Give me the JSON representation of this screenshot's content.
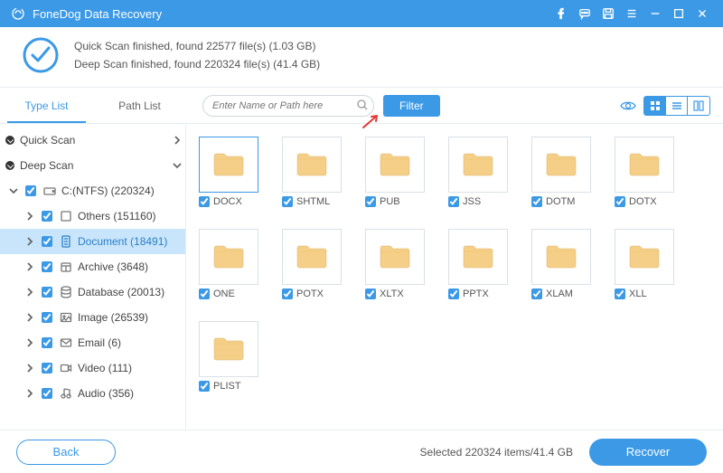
{
  "app_title": "FoneDog Data Recovery",
  "scan_status": {
    "quick": "Quick Scan finished, found 22577 file(s) (1.03 GB)",
    "deep": "Deep Scan finished, found 220324 file(s) (41.4 GB)"
  },
  "tabs": {
    "type_list": "Type List",
    "path_list": "Path List"
  },
  "toolbar": {
    "search_placeholder": "Enter Name or Path here",
    "filter": "Filter"
  },
  "tree": {
    "quick_scan": "Quick Scan",
    "deep_scan": "Deep Scan",
    "drive": "C:(NTFS) (220324)",
    "children": [
      {
        "label": "Others (151160)",
        "icon": "others"
      },
      {
        "label": "Document (18491)",
        "icon": "document",
        "active": true
      },
      {
        "label": "Archive (3648)",
        "icon": "archive"
      },
      {
        "label": "Database (20013)",
        "icon": "database"
      },
      {
        "label": "Image (26539)",
        "icon": "image"
      },
      {
        "label": "Email (6)",
        "icon": "email"
      },
      {
        "label": "Video (111)",
        "icon": "video"
      },
      {
        "label": "Audio (356)",
        "icon": "audio"
      }
    ]
  },
  "grid_items": [
    {
      "name": "DOCX"
    },
    {
      "name": "SHTML"
    },
    {
      "name": "PUB"
    },
    {
      "name": "JSS"
    },
    {
      "name": "DOTM"
    },
    {
      "name": "DOTX"
    },
    {
      "name": "ONE"
    },
    {
      "name": "POTX"
    },
    {
      "name": "XLTX"
    },
    {
      "name": "PPTX"
    },
    {
      "name": "XLAM"
    },
    {
      "name": "XLL"
    },
    {
      "name": "PLIST"
    }
  ],
  "footer": {
    "back": "Back",
    "selected": "Selected 220324 items/41.4 GB",
    "recover": "Recover"
  },
  "colors": {
    "accent": "#3b99e6"
  }
}
